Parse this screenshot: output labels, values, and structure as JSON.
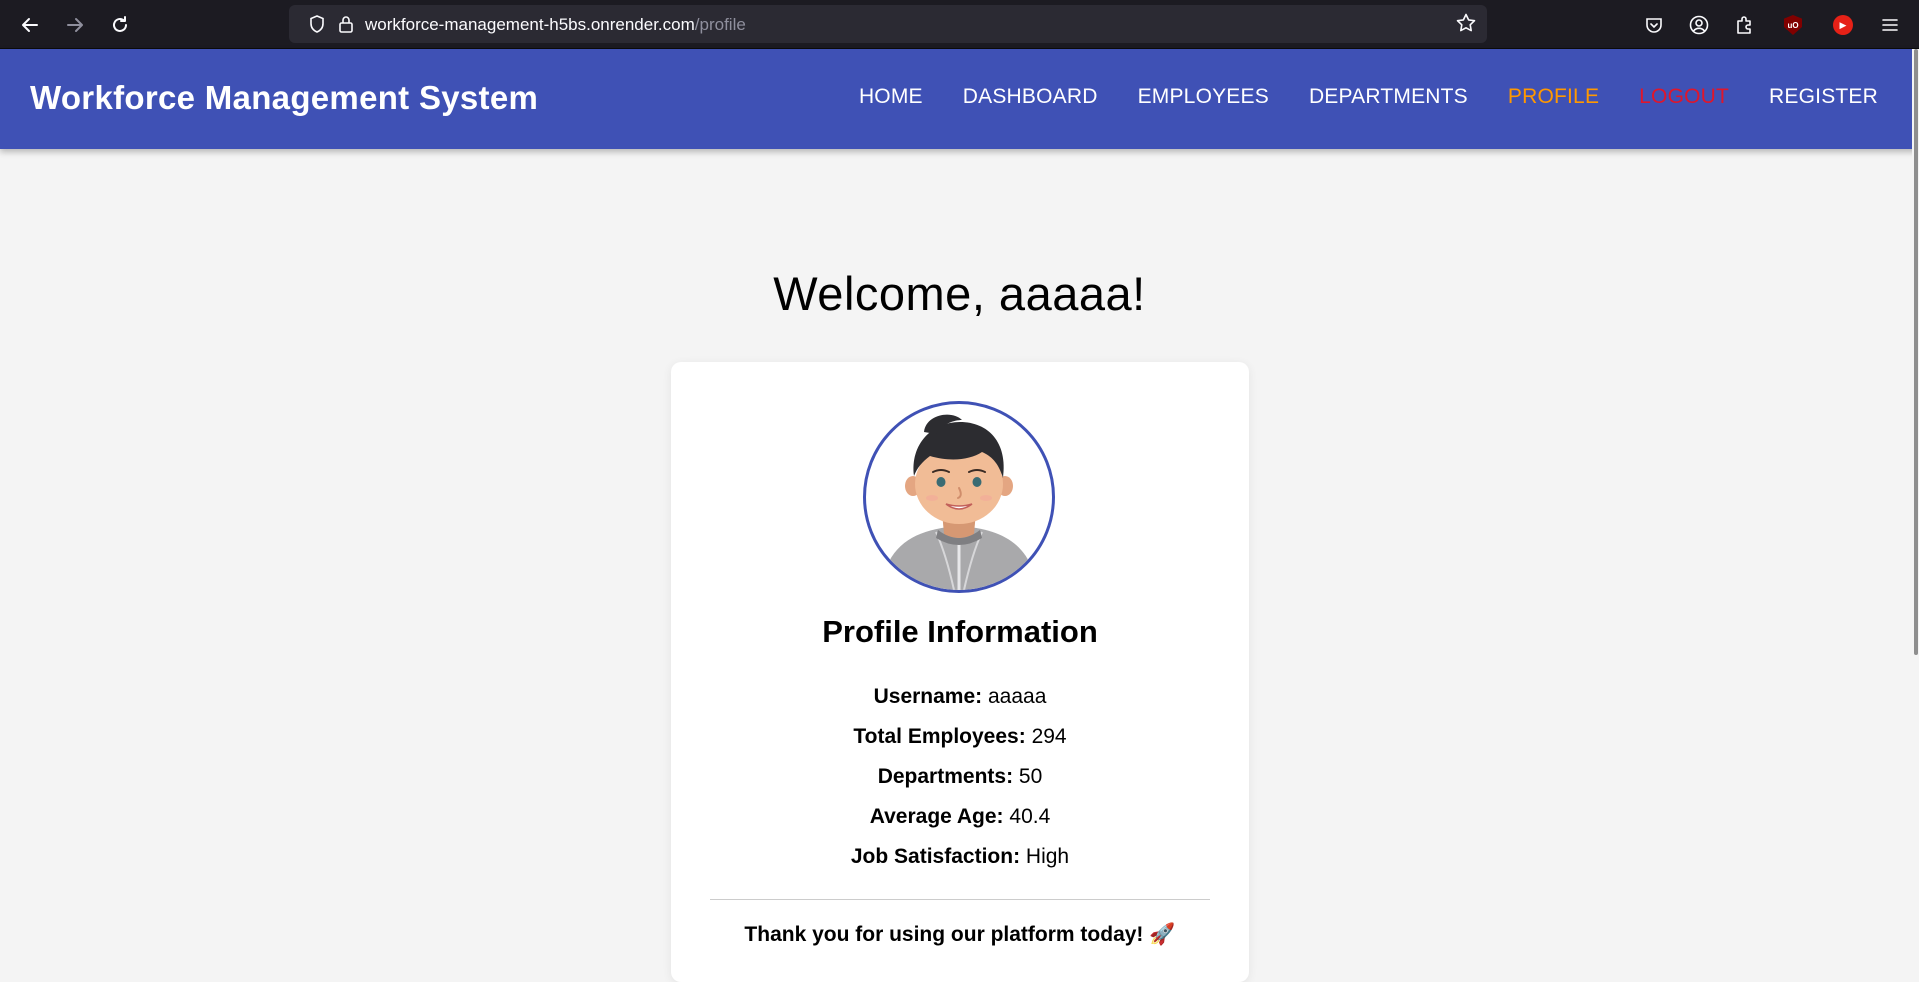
{
  "browser": {
    "url_host": "workforce-management-h5bs.onrender.com",
    "url_path": "/profile",
    "icons": {
      "back": "arrow-left-icon",
      "forward": "arrow-right-icon",
      "reload": "reload-icon",
      "tracking": "shield-icon",
      "secure": "lock-icon",
      "bookmark": "star-icon",
      "pocket": "pocket-icon",
      "account": "account-icon",
      "extensions": "puzzle-icon",
      "ublock": "ublock-icon",
      "youtube": "youtube-icon",
      "menu": "hamburger-icon"
    },
    "ublock_label": "uO"
  },
  "navbar": {
    "brand": "Workforce Management System",
    "links": [
      {
        "label": "HOME",
        "state": "default"
      },
      {
        "label": "DASHBOARD",
        "state": "default"
      },
      {
        "label": "EMPLOYEES",
        "state": "default"
      },
      {
        "label": "DEPARTMENTS",
        "state": "default"
      },
      {
        "label": "PROFILE",
        "state": "active"
      },
      {
        "label": "LOGOUT",
        "state": "danger"
      },
      {
        "label": "REGISTER",
        "state": "default"
      }
    ],
    "colors": {
      "background": "#3f51b5",
      "active": "#ff9800",
      "logout": "#e0162b"
    }
  },
  "main": {
    "welcome": "Welcome, aaaaa!",
    "card": {
      "avatar": "avatar-illustration",
      "heading": "Profile Information",
      "fields": [
        {
          "label": "Username:",
          "value": "aaaaa"
        },
        {
          "label": "Total Employees:",
          "value": "294"
        },
        {
          "label": "Departments:",
          "value": "50"
        },
        {
          "label": "Average Age:",
          "value": "40.4"
        },
        {
          "label": "Job Satisfaction:",
          "value": "High"
        }
      ],
      "thanks": "Thank you for using our platform today!",
      "thanks_emoji": "🚀"
    }
  }
}
